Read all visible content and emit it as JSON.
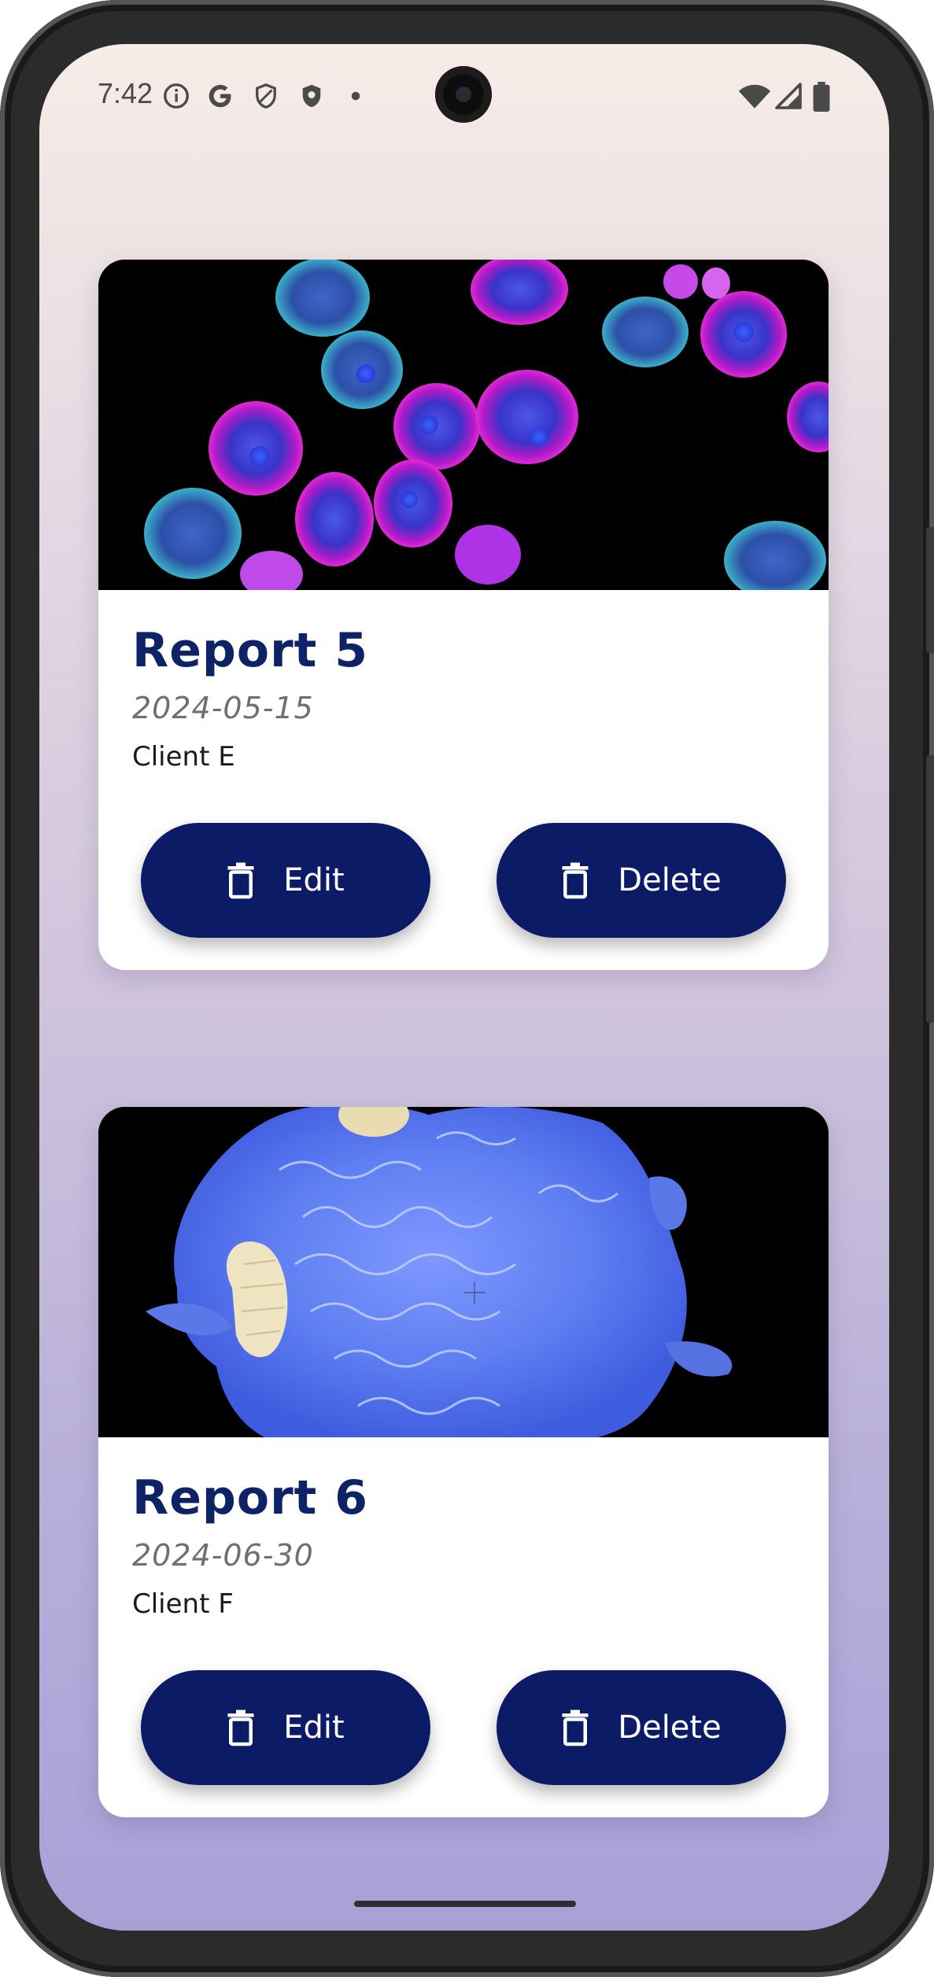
{
  "status_bar": {
    "time": "7:42",
    "left_icons": [
      "info-icon",
      "google-icon",
      "shield-icon",
      "shield-badge-icon",
      "dot-icon"
    ],
    "right_icons": [
      "wifi-icon",
      "signal-icon",
      "battery-icon"
    ]
  },
  "cards": [
    {
      "title": "Report 5",
      "date": "2024-05-15",
      "client": "Client E",
      "image": "fluorescent-cells-image",
      "edit_label": "Edit",
      "delete_label": "Delete"
    },
    {
      "title": "Report 6",
      "date": "2024-06-30",
      "client": "Client F",
      "image": "blue-cell-microscopy-image",
      "edit_label": "Edit",
      "delete_label": "Delete"
    }
  ],
  "colors": {
    "accent": "#0c1b66",
    "title": "#0e2266"
  }
}
